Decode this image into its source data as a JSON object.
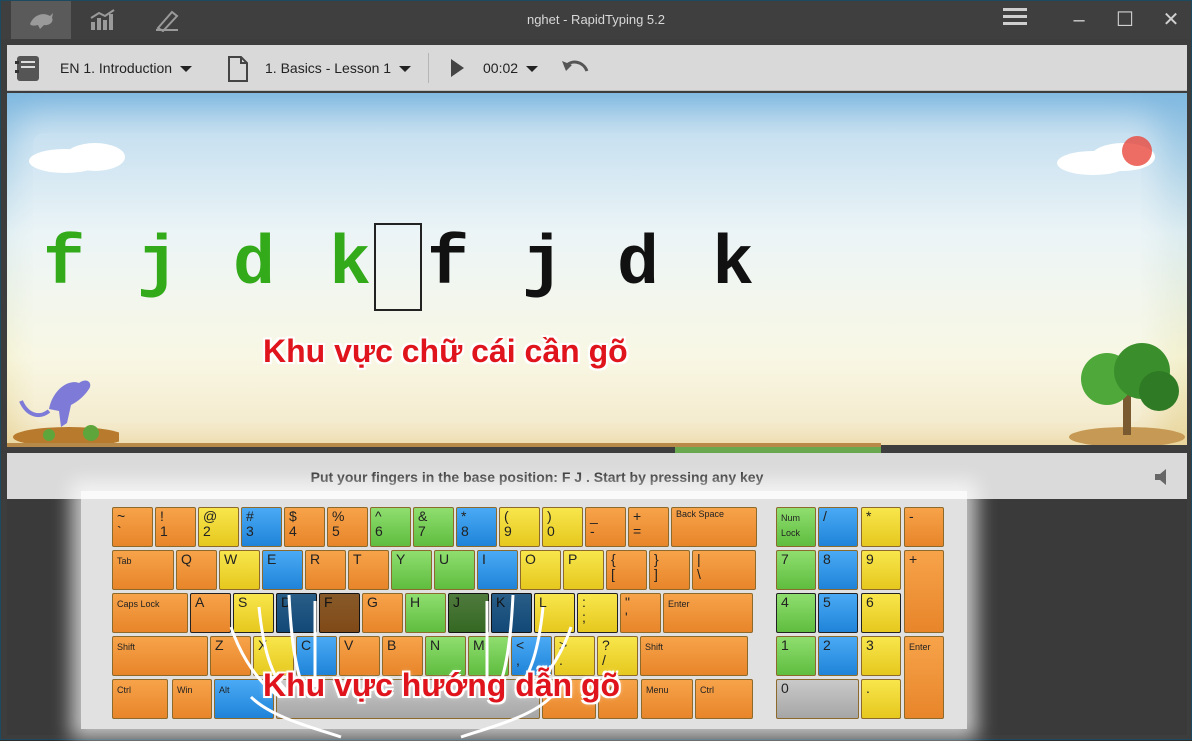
{
  "window": {
    "title": "nghet - RapidTyping 5.2"
  },
  "titlebar": {
    "tabs": [
      "typing-tutor-icon",
      "statistics-icon",
      "lesson-editor-icon"
    ],
    "menu_icon": "hamburger-menu-icon",
    "minimize": "–",
    "maximize": "☐",
    "close": "✕"
  },
  "toolbar": {
    "course": "EN 1. Introduction",
    "lesson": "1. Basics - Lesson 1",
    "timer": "00:02"
  },
  "lesson": {
    "typed": [
      "f",
      "j",
      "d",
      "k"
    ],
    "remaining": [
      "f",
      "j",
      "d",
      "k"
    ],
    "typed_color": "#33aa1a",
    "remaining_color": "#111111"
  },
  "annotations": {
    "typing_area": "Khu vực chữ cái cần gõ",
    "guide_area": "Khu vực hướng dẫn gõ"
  },
  "status": {
    "message": "Put your fingers in the base position:  F  J .  Start by pressing any key"
  },
  "keyboard": {
    "row1": [
      [
        "~",
        "`"
      ],
      [
        "!",
        "1"
      ],
      [
        "@",
        "2"
      ],
      [
        "#",
        "3"
      ],
      [
        "$",
        "4"
      ],
      [
        "%",
        "5"
      ],
      [
        "^",
        "6"
      ],
      [
        "&",
        "7"
      ],
      [
        "*",
        "8"
      ],
      [
        "(",
        "9"
      ],
      [
        ")",
        "0"
      ],
      [
        "_",
        "-"
      ],
      [
        "+",
        "="
      ],
      [
        "Back Space",
        ""
      ]
    ],
    "row2": [
      "Tab",
      "Q",
      "W",
      "E",
      "R",
      "T",
      "Y",
      "U",
      "I",
      "O",
      "P",
      [
        "{",
        "["
      ],
      [
        "}",
        "]"
      ],
      [
        "|",
        "\\"
      ]
    ],
    "row3": [
      "Caps Lock",
      "A",
      "S",
      "D",
      "F",
      "G",
      "H",
      "J",
      "K",
      "L",
      [
        ":",
        ";"
      ],
      [
        "\"",
        "'"
      ],
      "Enter"
    ],
    "row4": [
      "Shift",
      "Z",
      "X",
      "C",
      "V",
      "B",
      "N",
      "M",
      [
        "<",
        ","
      ],
      [
        ">",
        "."
      ],
      [
        "?",
        "/"
      ],
      "Shift"
    ],
    "row5": [
      "Ctrl",
      "Win",
      "Alt",
      "",
      "Alt",
      "Win",
      "Menu",
      "Ctrl"
    ],
    "numpad": {
      "r1": [
        "Num Lock",
        "/",
        "*",
        "-"
      ],
      "r2": [
        "7",
        "8",
        "9",
        "+"
      ],
      "r3": [
        "4",
        "5",
        "6"
      ],
      "r4": [
        "1",
        "2",
        "3",
        "Enter"
      ],
      "r5": [
        "0",
        "."
      ]
    }
  },
  "colors": {
    "orange": "#ef9138",
    "yellow": "#f0d838",
    "green": "#72cc52",
    "blue": "#2c95e6",
    "accent_red": "#e0141c"
  }
}
